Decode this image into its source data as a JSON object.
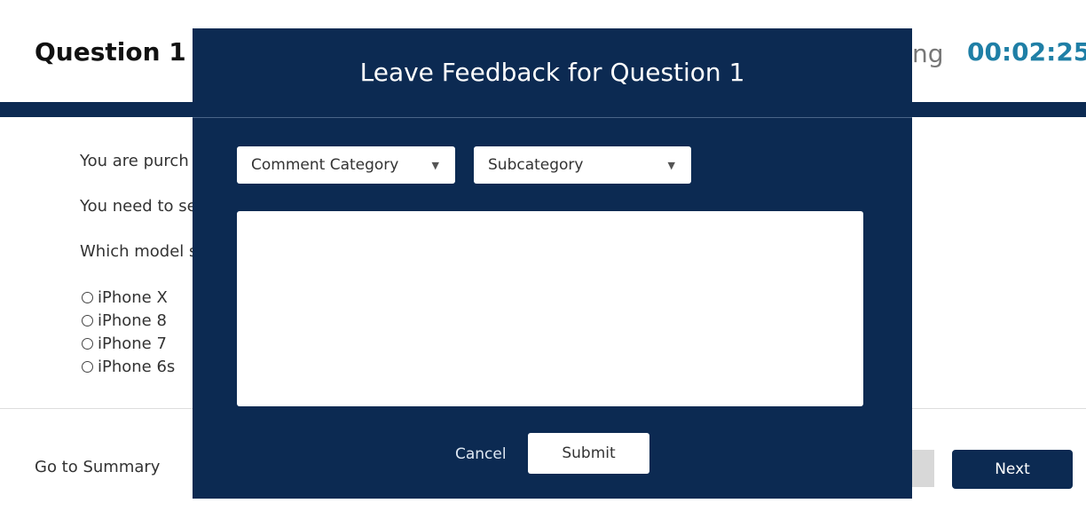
{
  "header": {
    "question_title": "Question 1",
    "time_label_partial": "ng",
    "timer": "00:02:25"
  },
  "question": {
    "lines": [
      "You are purch",
      "You need to se",
      "Which model s"
    ],
    "options": [
      "iPhone X",
      "iPhone 8",
      "iPhone 7",
      "iPhone 6s"
    ]
  },
  "footer": {
    "go_to_summary": "Go to Summary",
    "next_label": "Next"
  },
  "modal": {
    "title": "Leave Feedback for Question 1",
    "category_dropdown": {
      "selected": "Comment Category"
    },
    "subcategory_dropdown": {
      "selected": "Subcategory"
    },
    "comment_value": "",
    "cancel_label": "Cancel",
    "submit_label": "Submit"
  },
  "colors": {
    "navy": "#0c2a52",
    "timer_teal": "#1f7fa6"
  },
  "icons": {
    "dropdown_caret": "caret-down-icon",
    "radio": "radio-unchecked-icon"
  }
}
